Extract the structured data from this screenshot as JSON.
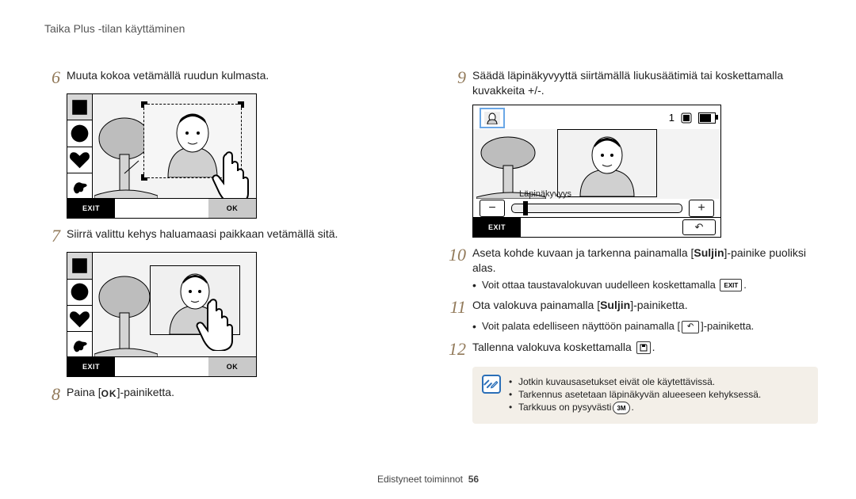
{
  "section_title": "Taika Plus -tilan käyttäminen",
  "left": {
    "s6": {
      "num": "6",
      "text": "Muuta kokoa vetämällä ruudun kulmasta."
    },
    "s7": {
      "num": "7",
      "text": "Siirrä valittu kehys haluamaasi paikkaan vetämällä sitä."
    },
    "s8": {
      "num": "8",
      "text_before": "Paina [",
      "ok": "o",
      "text_after": "]-painiketta."
    },
    "screen_exit": "EXIT",
    "screen_ok": "OK"
  },
  "right": {
    "s9": {
      "num": "9",
      "text": "Säädä läpinäkyvyyttä siirtämällä liukusäätimiä tai koskettamalla kuvakkeita +/-."
    },
    "s10": {
      "num": "10",
      "text_a": "Aseta kohde kuvaan ja tarkenna painamalla [",
      "bold_a": "Suljin",
      "text_b": "]-painike puoliksi alas.",
      "bullet_a_before": "Voit ottaa taustavalokuvan uudelleen koskettamalla ",
      "bullet_a_chip": "EXIT",
      "bullet_a_after": "."
    },
    "s11": {
      "num": "11",
      "text_a": "Ota valokuva painamalla [",
      "bold_a": "Suljin",
      "text_b": "]-painiketta.",
      "bullet_a_before": "Voit palata edelliseen näyttöön painamalla [",
      "bullet_a_chip": "↶",
      "bullet_a_after": "]-painiketta."
    },
    "s12": {
      "num": "12",
      "text_before": "Tallenna valokuva koskettamalla ",
      "save_chip": "💾",
      "text_after": "."
    },
    "info": {
      "b1": "Jotkin kuvausasetukset eivät ole käytettävissä.",
      "b2": "Tarkennus asetetaan läpinäkyvän alueeseen kehyksessä.",
      "b3_before": "Tarkkuus on pysyvästi ",
      "b3_chip": "3M",
      "b3_after": "."
    },
    "screen2": {
      "count": "1",
      "trans_label": "Läpinäkyvyys",
      "exit": "EXIT"
    }
  },
  "footer": {
    "label": "Edistyneet toiminnot",
    "page": "56"
  }
}
